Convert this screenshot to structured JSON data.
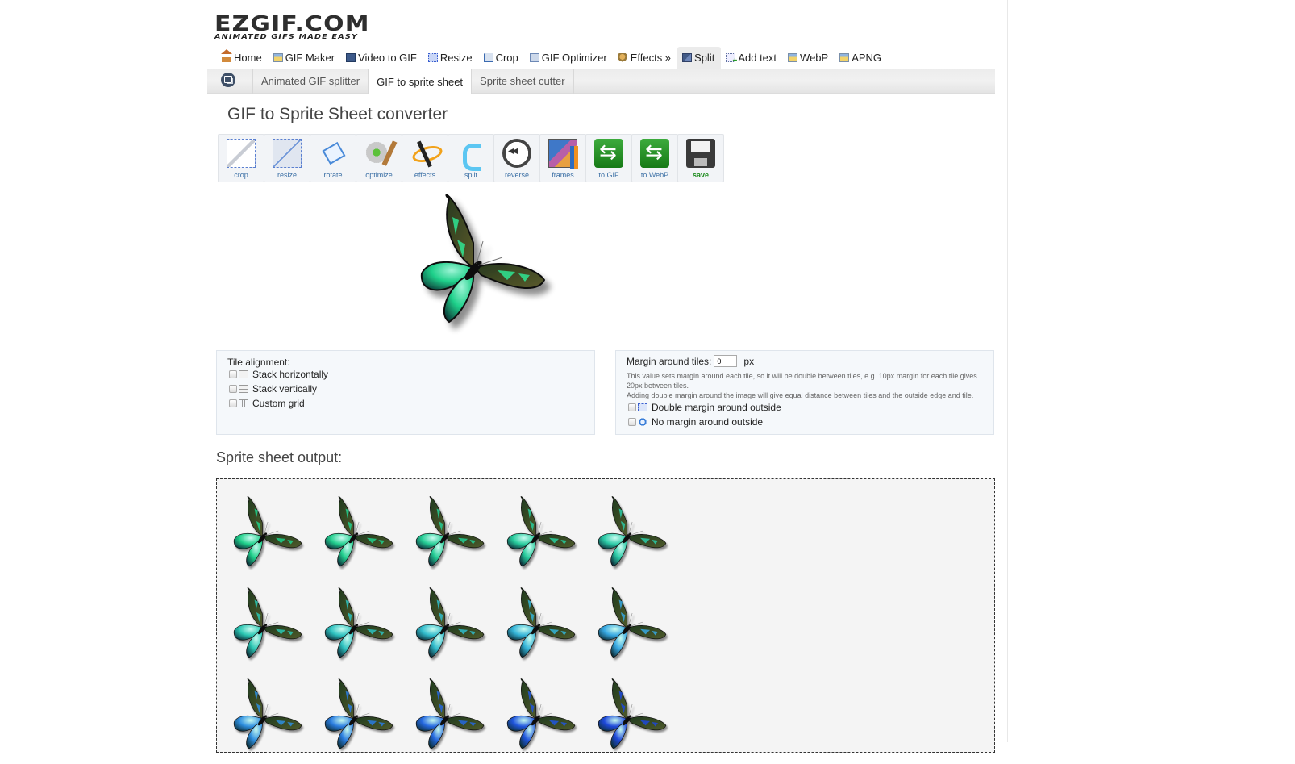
{
  "logo": {
    "main": "EZGIF.COM",
    "tagline": "ANIMATED GIFS MADE EASY"
  },
  "topnav": [
    {
      "label": "Home",
      "icon": "home-icon",
      "active": false
    },
    {
      "label": "GIF Maker",
      "icon": "image-icon",
      "active": false
    },
    {
      "label": "Video to GIF",
      "icon": "film-icon",
      "active": false
    },
    {
      "label": "Resize",
      "icon": "resize-icon",
      "active": false
    },
    {
      "label": "Crop",
      "icon": "crop-icon",
      "active": false
    },
    {
      "label": "GIF Optimizer",
      "icon": "optimizer-icon",
      "active": false
    },
    {
      "label": "Effects »",
      "icon": "palette-icon",
      "active": false
    },
    {
      "label": "Split",
      "icon": "split-icon",
      "active": true
    },
    {
      "label": "Add text",
      "icon": "add-text-icon",
      "active": false
    },
    {
      "label": "WebP",
      "icon": "image-icon",
      "active": false
    },
    {
      "label": "APNG",
      "icon": "image-icon",
      "active": false
    }
  ],
  "subtabs": [
    {
      "label": "Animated GIF splitter",
      "active": false
    },
    {
      "label": "GIF to sprite sheet",
      "active": true
    },
    {
      "label": "Sprite sheet cutter",
      "active": false
    }
  ],
  "page_title": "GIF to Sprite Sheet converter",
  "tools": [
    {
      "label": "crop",
      "icon": "crop-tool-icon"
    },
    {
      "label": "resize",
      "icon": "resize-tool-icon"
    },
    {
      "label": "rotate",
      "icon": "rotate-tool-icon"
    },
    {
      "label": "optimize",
      "icon": "optimize-tool-icon"
    },
    {
      "label": "effects",
      "icon": "effects-tool-icon"
    },
    {
      "label": "split",
      "icon": "split-tool-icon"
    },
    {
      "label": "reverse",
      "icon": "reverse-tool-icon"
    },
    {
      "label": "frames",
      "icon": "frames-tool-icon"
    },
    {
      "label": "to GIF",
      "icon": "convert-gif-icon"
    },
    {
      "label": "to WebP",
      "icon": "convert-webp-icon"
    },
    {
      "label": "save",
      "icon": "save-icon"
    }
  ],
  "alignment": {
    "label": "Tile alignment:",
    "options": [
      {
        "label": "Stack horizontally",
        "checked": false
      },
      {
        "label": "Stack vertically",
        "checked": false
      },
      {
        "label": "Custom grid",
        "checked": false
      }
    ]
  },
  "margin": {
    "label": "Margin around tiles:",
    "value": "0",
    "unit": "px",
    "help1": "This value sets margin around each tile, so it will be double between tiles, e.g. 10px margin for each tile gives 20px between tiles.",
    "help2": "Adding double margin around the image will give equal distance between tiles and the outside edge and tile.",
    "options": [
      {
        "label": "Double margin around outside",
        "checked": false
      },
      {
        "label": "No margin around outside",
        "checked": false
      }
    ]
  },
  "output": {
    "title": "Sprite sheet output:",
    "columns": 5,
    "frame_colors": [
      [
        "#1fd08a",
        "#22cf8e",
        "#25cd95",
        "#28cc9d",
        "#2bcaa6"
      ],
      [
        "#2bc7b3",
        "#2ec2c0",
        "#31bccc",
        "#34b4d8",
        "#37a8e2"
      ],
      [
        "#2f8fe0",
        "#2a7ce0",
        "#2568e0",
        "#2156de",
        "#1e48da"
      ]
    ]
  }
}
